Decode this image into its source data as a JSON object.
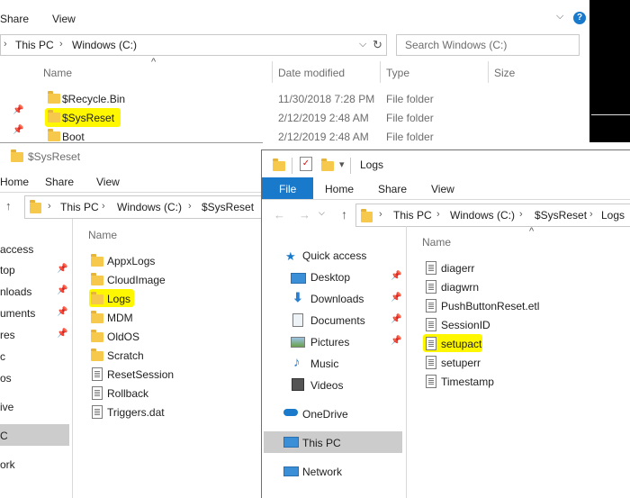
{
  "win1": {
    "tabs": [
      "Share",
      "View"
    ],
    "address": [
      "This PC",
      "Windows (C:)"
    ],
    "search_placeholder": "Search Windows (C:)",
    "columns": [
      "Name",
      "Date modified",
      "Type",
      "Size"
    ],
    "rows": [
      {
        "name": "$Recycle.Bin",
        "date": "11/30/2018 7:28 PM",
        "type": "File folder"
      },
      {
        "name": "$SysReset",
        "date": "2/12/2019 2:48 AM",
        "type": "File folder"
      },
      {
        "name": "Boot",
        "date": "2/12/2019 2:48 AM",
        "type": "File folder"
      }
    ]
  },
  "win2": {
    "title": "$SysReset",
    "tabs": [
      "Home",
      "Share",
      "View"
    ],
    "address": [
      "This PC",
      "Windows (C:)",
      "$SysReset"
    ],
    "nav": [
      "access",
      "top",
      "nloads",
      "uments",
      "res",
      "c",
      "os",
      "ive",
      "C",
      "ork"
    ],
    "column": "Name",
    "items": [
      {
        "name": "AppxLogs",
        "kind": "folder"
      },
      {
        "name": "CloudImage",
        "kind": "folder"
      },
      {
        "name": "Logs",
        "kind": "folder"
      },
      {
        "name": "MDM",
        "kind": "folder"
      },
      {
        "name": "OldOS",
        "kind": "folder"
      },
      {
        "name": "Scratch",
        "kind": "folder"
      },
      {
        "name": "ResetSession",
        "kind": "file"
      },
      {
        "name": "Rollback",
        "kind": "file"
      },
      {
        "name": "Triggers.dat",
        "kind": "file"
      }
    ]
  },
  "win3": {
    "title": "Logs",
    "tabs": [
      "File",
      "Home",
      "Share",
      "View"
    ],
    "address": [
      "This PC",
      "Windows (C:)",
      "$SysReset",
      "Logs"
    ],
    "column": "Name",
    "nav": [
      {
        "label": "Quick access",
        "icon": "star-icon"
      },
      {
        "label": "Desktop",
        "icon": "desktop-icon"
      },
      {
        "label": "Downloads",
        "icon": "download-icon"
      },
      {
        "label": "Documents",
        "icon": "documents-icon"
      },
      {
        "label": "Pictures",
        "icon": "pictures-icon"
      },
      {
        "label": "Music",
        "icon": "music-icon"
      },
      {
        "label": "Videos",
        "icon": "videos-icon"
      },
      {
        "label": "OneDrive",
        "icon": "cloud-icon"
      },
      {
        "label": "This PC",
        "icon": "computer-icon"
      },
      {
        "label": "Network",
        "icon": "network-icon"
      }
    ],
    "items": [
      "diagerr",
      "diagwrn",
      "PushButtonReset.etl",
      "SessionID",
      "setupact",
      "setuperr",
      "Timestamp"
    ]
  },
  "colors": {
    "accent": "#1979ca",
    "highlight": "#fff700",
    "selected": "#cccccc"
  }
}
